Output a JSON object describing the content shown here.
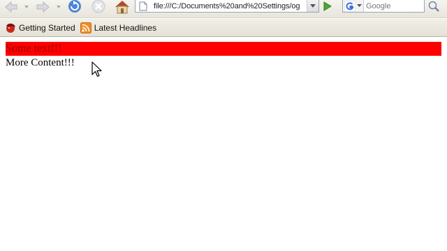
{
  "navigation": {
    "back_label": "Back",
    "forward_label": "Forward",
    "reload_label": "Reload",
    "stop_label": "Stop",
    "home_label": "Home",
    "go_label": "Go"
  },
  "address_bar": {
    "url": "file:///C:/Documents%20and%20Settings/og"
  },
  "search": {
    "engine_name": "Google",
    "engine_icon": "google-g-icon",
    "placeholder": "Google"
  },
  "bookmarks": [
    {
      "label": "Getting Started",
      "icon": "firefox-bookmark-icon"
    },
    {
      "label": "Latest Headlines",
      "icon": "rss-feed-icon"
    }
  ],
  "page": {
    "banner_text": "Some text!!!",
    "more_content_text": "More Content!!!"
  },
  "colors": {
    "banner_background": "#ff0000",
    "banner_text": "#990000",
    "page_background": "#ffffff"
  }
}
